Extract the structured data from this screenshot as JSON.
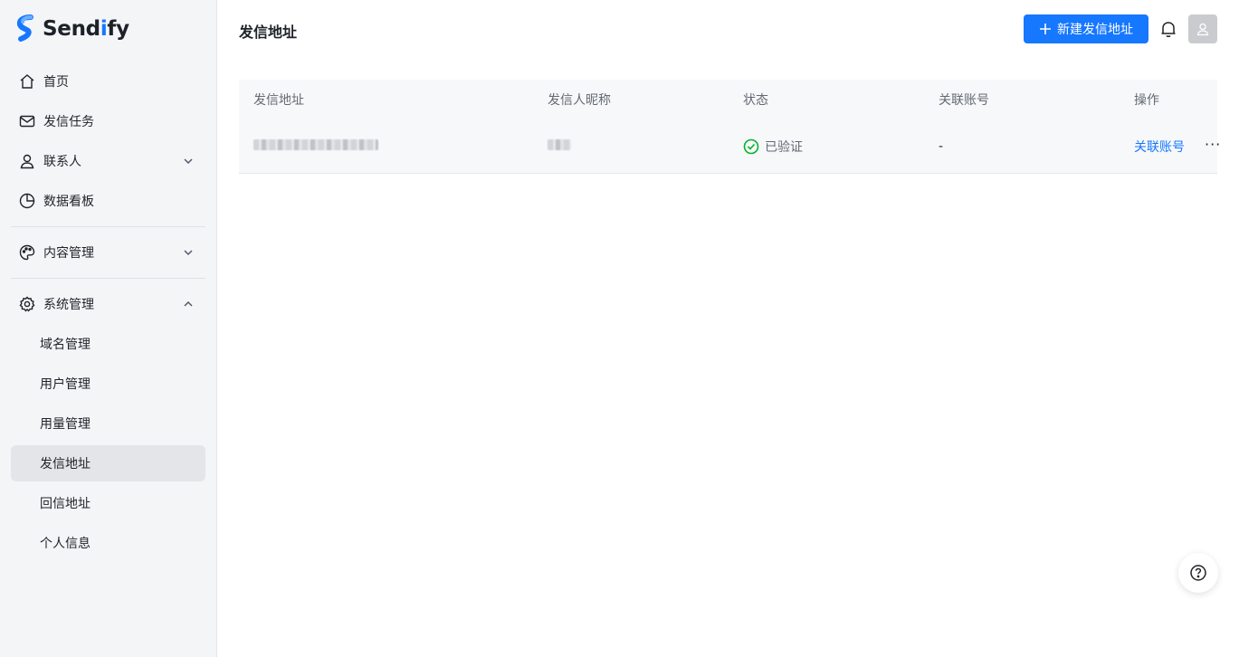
{
  "brand": {
    "name_prefix": "Send",
    "name_accent": "i",
    "name_suffix": "fy",
    "accent_color": "#1677ff"
  },
  "sidebar": {
    "items": [
      {
        "label": "首页",
        "icon": "home-icon"
      },
      {
        "label": "发信任务",
        "icon": "mail-icon"
      },
      {
        "label": "联系人",
        "icon": "user-icon",
        "expandable": true,
        "expanded": false
      },
      {
        "label": "数据看板",
        "icon": "pie-chart-icon"
      },
      {
        "label": "内容管理",
        "icon": "palette-icon",
        "expandable": true,
        "expanded": false
      },
      {
        "label": "系统管理",
        "icon": "gear-icon",
        "expandable": true,
        "expanded": true
      }
    ],
    "system_sub_items": [
      {
        "label": "域名管理"
      },
      {
        "label": "用户管理"
      },
      {
        "label": "用量管理"
      },
      {
        "label": "发信地址",
        "active": true
      },
      {
        "label": "回信地址"
      },
      {
        "label": "个人信息"
      }
    ]
  },
  "header": {
    "title": "发信地址",
    "new_button_label": "新建发信地址"
  },
  "table": {
    "columns": [
      "发信地址",
      "发信人昵称",
      "状态",
      "关联账号",
      "操作"
    ],
    "rows": [
      {
        "address": "",
        "nickname": "",
        "status": "已验证",
        "linked_account": "-",
        "action_label": "关联账号",
        "more": "···"
      }
    ]
  },
  "colors": {
    "primary": "#1677ff",
    "success": "#00b42a",
    "sidebar_bg": "#f4f5f7"
  }
}
